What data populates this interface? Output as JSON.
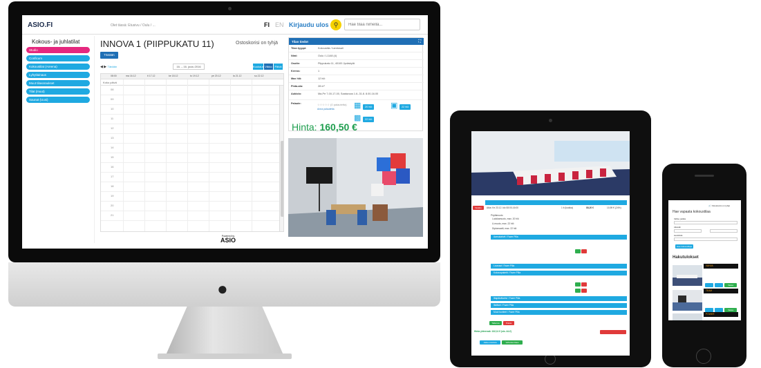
{
  "colors": {
    "brand_blue": "#1f6fb5",
    "accent_cyan": "#1fa9e1",
    "active_pink": "#e5287e",
    "price_green": "#1e9e4e",
    "search_yellow": "#f6d200"
  },
  "desktop": {
    "logo": "ASIO.FI",
    "breadcrumb": "Olet tässä: Etusivu / Oulu / ...",
    "lang_fi": "FI",
    "lang_en": "EN",
    "logout": "Kirjaudu ulos",
    "search_icon": "search-icon",
    "search_placeholder": "Hae tilaa nimellä...",
    "sidebar": {
      "title": "Kokous- ja juhlatilat",
      "items": [
        {
          "label": "Studio"
        },
        {
          "label": "Conficum"
        },
        {
          "label": "Kokoustilat (Areena)"
        },
        {
          "label": "Lyhytlainaus"
        },
        {
          "label": "Muut tilavaraukset"
        },
        {
          "label": "Tilat (muut)"
        },
        {
          "label": "Saunat (Uusi)"
        }
      ]
    },
    "room_title": "INNOVA 1 (PIIPPUKATU 11)",
    "cart_status": "Ostoskorisi on tyhjä",
    "book_button": "Tänään",
    "nav": {
      "prev": "◀",
      "next": "▶",
      "today": "Tänään"
    },
    "date_range": "16. – 16. joulu 2016",
    "views": {
      "month": "Kuukausi",
      "week": "Viikko",
      "day": "Päivä"
    },
    "calendar": {
      "time_header": "08:00",
      "days": [
        "ma 16.12",
        "ti 17.12",
        "ke 18.12",
        "to 19.12",
        "pe 20.12",
        "la 21.12",
        "su 22.12"
      ],
      "all_day": "Koko päivä",
      "hours": [
        "08",
        "09",
        "10",
        "11",
        "12",
        "13",
        "14",
        "15",
        "16",
        "17",
        "18",
        "19",
        "20",
        "21"
      ]
    },
    "powered": {
      "small": "Powered by",
      "big": "ASIO"
    },
    "info": {
      "header": "Tilan tiedot",
      "rows": [
        {
          "k": "Tilan tyyppi:",
          "v": "Kokoustila / luentosali"
        },
        {
          "k": "Nimi:",
          "v": "Oulu / L1148 (4)"
        },
        {
          "k": "Osoite:",
          "v": "Piippukatu 11, 40100 Jyväskylä"
        },
        {
          "k": "Kerros:",
          "v": "1"
        },
        {
          "k": "Max hlö:",
          "v": "12 hlö"
        },
        {
          "k": "Pinta-ala:",
          "v": "28 m²"
        },
        {
          "k": "Aukiolo:",
          "v": "Ma-Pe 7-00-17-00, Saatavuus 1.6.-31.8. 8.00-16.00"
        },
        {
          "k": "Palaute:",
          "v": ""
        }
      ],
      "stars": "☆☆☆☆☆ (0 palautetta)",
      "reviews_link": "Anna palautetta",
      "seatings": [
        "20 hlö",
        "22 hlö",
        "22 hlö"
      ],
      "price_label": "Hinta:",
      "price": "160,50 €"
    }
  },
  "tablet": {
    "status_badge": "Varattu",
    "booking_line": "Aika: Ke 23.12. klo 08:00-16:00",
    "booking_count": "1 ti (luokka)",
    "booking_price": "88,20 €",
    "booking_vat": "10,59 € (24%)",
    "seating_title": "Pöytämuoto",
    "seating_options": [
      "Luokkamuoto, max. 20 hlö",
      "U-muoto, max. 22 hlö",
      "Diplomaatti, max. 22 hlö"
    ],
    "sections": [
      "Aamukahvit / Fazer Pilla",
      "Lounaat / Fazer Pilla",
      "Kokouspaketit / Fazer Pilla",
      "Iltapäiväkahvi / Fazer Pilla",
      "Illalliset / Fazer Pilla",
      "Muut tuotteet / Fazer Pilla"
    ],
    "total": "Hinta yhteensä: 132,11 € (sis. ALV)",
    "buttons": {
      "save": "Tallenna",
      "remove": "Poista",
      "back": "Jatka ostoksia",
      "confirm": "Vahvista tilaus"
    }
  },
  "phone": {
    "cart": "Ostoskorisi on tyhjä",
    "search_title": "Hae vapaata kokoustilaa",
    "fields": [
      "Valitse paikka",
      "Aikaväli",
      "Henkilöitä"
    ],
    "search_button": "Hae kokoustiloja",
    "results_title": "Hakutulokset",
    "results": [
      {
        "name": "VAHVA"
      },
      {
        "name": "TEAM"
      },
      {
        "name": "POWER"
      }
    ],
    "result_button": "Varaa"
  }
}
